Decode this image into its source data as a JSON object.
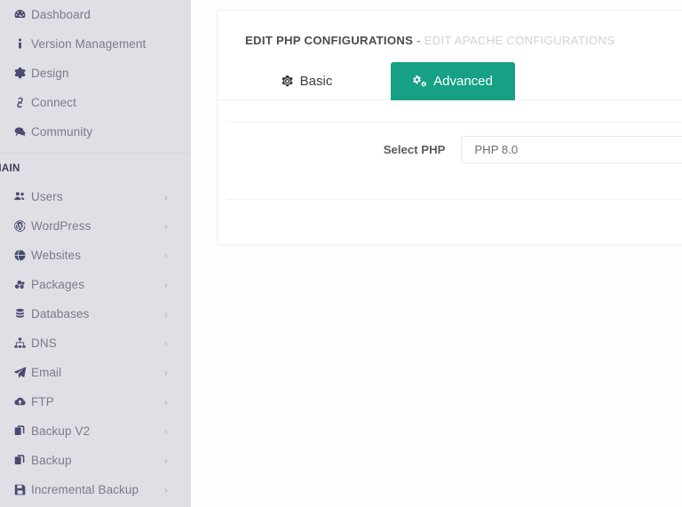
{
  "sidebar": {
    "top_items": [
      {
        "label": "Dashboard",
        "icon": "dashboard-icon",
        "has_chevron": false
      },
      {
        "label": "Version Management",
        "icon": "info-icon",
        "has_chevron": false
      },
      {
        "label": "Design",
        "icon": "gear-icon",
        "has_chevron": false
      },
      {
        "label": "Connect",
        "icon": "link-icon",
        "has_chevron": false
      },
      {
        "label": "Community",
        "icon": "comments-icon",
        "has_chevron": false
      }
    ],
    "section_label": "MAIN",
    "main_items": [
      {
        "label": "Users",
        "icon": "users-icon",
        "has_chevron": true
      },
      {
        "label": "WordPress",
        "icon": "wordpress-icon",
        "has_chevron": true
      },
      {
        "label": "Websites",
        "icon": "globe-icon",
        "has_chevron": true
      },
      {
        "label": "Packages",
        "icon": "packages-icon",
        "has_chevron": true
      },
      {
        "label": "Databases",
        "icon": "database-icon",
        "has_chevron": true
      },
      {
        "label": "DNS",
        "icon": "sitemap-icon",
        "has_chevron": true
      },
      {
        "label": "Email",
        "icon": "paper-plane-icon",
        "has_chevron": true
      },
      {
        "label": "FTP",
        "icon": "cloud-upload-icon",
        "has_chevron": true
      },
      {
        "label": "Backup V2",
        "icon": "copy-icon",
        "has_chevron": true
      },
      {
        "label": "Backup",
        "icon": "copy-icon",
        "has_chevron": true
      },
      {
        "label": "Incremental Backup",
        "icon": "save-icon",
        "has_chevron": true
      }
    ],
    "chevron_glyph": "›"
  },
  "card": {
    "title_strong": "EDIT PHP CONFIGURATIONS",
    "title_dash": " - ",
    "title_muted": "EDIT APACHE CONFIGURATIONS",
    "tabs": [
      {
        "label": "Basic",
        "icon": "gear-icon",
        "active": false
      },
      {
        "label": "Advanced",
        "icon": "cogs-icon",
        "active": true
      }
    ],
    "form": {
      "select_php_label": "Select PHP",
      "select_php_value": "PHP 8.0"
    }
  },
  "colors": {
    "sidebar_bg": "#dfdfe5",
    "accent_teal": "#16a085",
    "nav_icon": "#4a4a72",
    "nav_text": "#7b7b8c",
    "title_strong": "#4b4b4b",
    "title_muted": "#cfd2d6"
  }
}
